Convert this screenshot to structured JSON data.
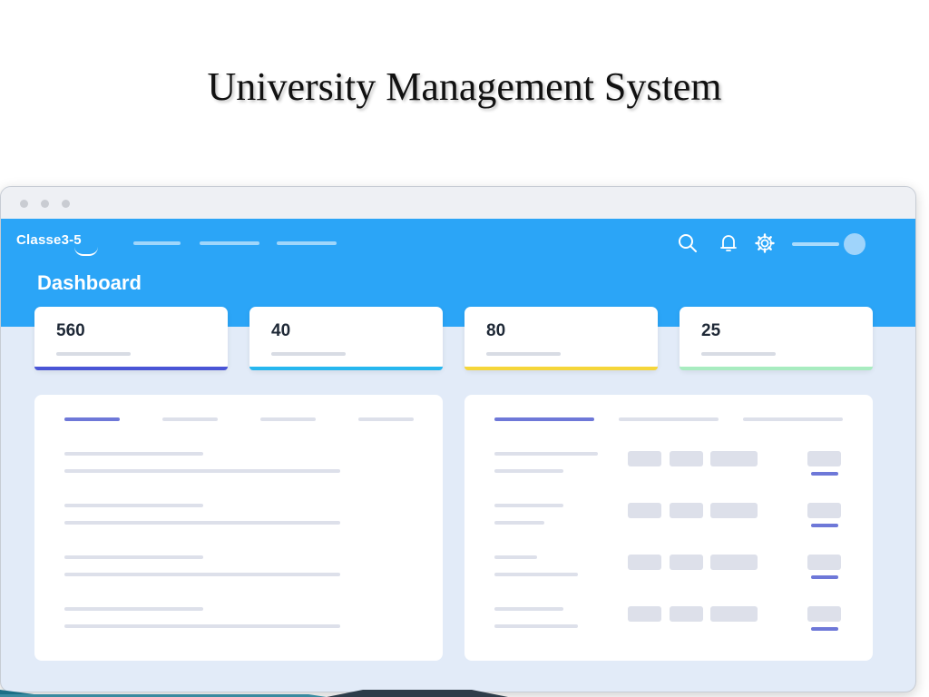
{
  "slide": {
    "title": "University Management System"
  },
  "app": {
    "logo": "Classe3-5",
    "page_title": "Dashboard",
    "header_icons": [
      "search-icon",
      "bell-icon",
      "gear-icon"
    ]
  },
  "stats": [
    {
      "value": "560",
      "accent": "#4a55d6"
    },
    {
      "value": "40",
      "accent": "#27b7ef"
    },
    {
      "value": "80",
      "accent": "#f5d63a"
    },
    {
      "value": "25",
      "accent": "#a8ecc0"
    }
  ],
  "colors": {
    "appbar": "#2ba5f7",
    "background": "#e2ebf8",
    "active_tab": "#6e78d8"
  }
}
